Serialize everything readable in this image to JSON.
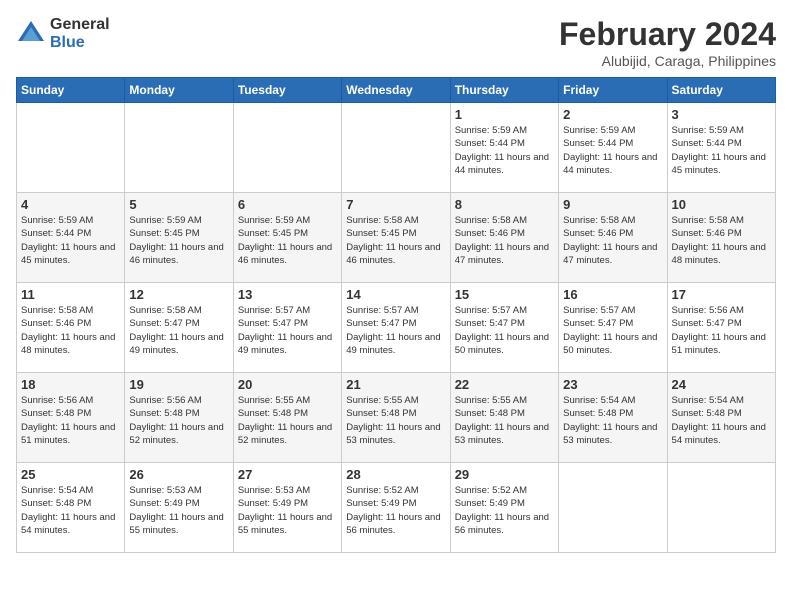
{
  "logo": {
    "general": "General",
    "blue": "Blue"
  },
  "title": "February 2024",
  "subtitle": "Alubijid, Caraga, Philippines",
  "headers": [
    "Sunday",
    "Monday",
    "Tuesday",
    "Wednesday",
    "Thursday",
    "Friday",
    "Saturday"
  ],
  "weeks": [
    [
      {
        "day": "",
        "info": ""
      },
      {
        "day": "",
        "info": ""
      },
      {
        "day": "",
        "info": ""
      },
      {
        "day": "",
        "info": ""
      },
      {
        "day": "1",
        "info": "Sunrise: 5:59 AM\nSunset: 5:44 PM\nDaylight: 11 hours\nand 44 minutes."
      },
      {
        "day": "2",
        "info": "Sunrise: 5:59 AM\nSunset: 5:44 PM\nDaylight: 11 hours\nand 44 minutes."
      },
      {
        "day": "3",
        "info": "Sunrise: 5:59 AM\nSunset: 5:44 PM\nDaylight: 11 hours\nand 45 minutes."
      }
    ],
    [
      {
        "day": "4",
        "info": "Sunrise: 5:59 AM\nSunset: 5:44 PM\nDaylight: 11 hours\nand 45 minutes."
      },
      {
        "day": "5",
        "info": "Sunrise: 5:59 AM\nSunset: 5:45 PM\nDaylight: 11 hours\nand 46 minutes."
      },
      {
        "day": "6",
        "info": "Sunrise: 5:59 AM\nSunset: 5:45 PM\nDaylight: 11 hours\nand 46 minutes."
      },
      {
        "day": "7",
        "info": "Sunrise: 5:58 AM\nSunset: 5:45 PM\nDaylight: 11 hours\nand 46 minutes."
      },
      {
        "day": "8",
        "info": "Sunrise: 5:58 AM\nSunset: 5:46 PM\nDaylight: 11 hours\nand 47 minutes."
      },
      {
        "day": "9",
        "info": "Sunrise: 5:58 AM\nSunset: 5:46 PM\nDaylight: 11 hours\nand 47 minutes."
      },
      {
        "day": "10",
        "info": "Sunrise: 5:58 AM\nSunset: 5:46 PM\nDaylight: 11 hours\nand 48 minutes."
      }
    ],
    [
      {
        "day": "11",
        "info": "Sunrise: 5:58 AM\nSunset: 5:46 PM\nDaylight: 11 hours\nand 48 minutes."
      },
      {
        "day": "12",
        "info": "Sunrise: 5:58 AM\nSunset: 5:47 PM\nDaylight: 11 hours\nand 49 minutes."
      },
      {
        "day": "13",
        "info": "Sunrise: 5:57 AM\nSunset: 5:47 PM\nDaylight: 11 hours\nand 49 minutes."
      },
      {
        "day": "14",
        "info": "Sunrise: 5:57 AM\nSunset: 5:47 PM\nDaylight: 11 hours\nand 49 minutes."
      },
      {
        "day": "15",
        "info": "Sunrise: 5:57 AM\nSunset: 5:47 PM\nDaylight: 11 hours\nand 50 minutes."
      },
      {
        "day": "16",
        "info": "Sunrise: 5:57 AM\nSunset: 5:47 PM\nDaylight: 11 hours\nand 50 minutes."
      },
      {
        "day": "17",
        "info": "Sunrise: 5:56 AM\nSunset: 5:47 PM\nDaylight: 11 hours\nand 51 minutes."
      }
    ],
    [
      {
        "day": "18",
        "info": "Sunrise: 5:56 AM\nSunset: 5:48 PM\nDaylight: 11 hours\nand 51 minutes."
      },
      {
        "day": "19",
        "info": "Sunrise: 5:56 AM\nSunset: 5:48 PM\nDaylight: 11 hours\nand 52 minutes."
      },
      {
        "day": "20",
        "info": "Sunrise: 5:55 AM\nSunset: 5:48 PM\nDaylight: 11 hours\nand 52 minutes."
      },
      {
        "day": "21",
        "info": "Sunrise: 5:55 AM\nSunset: 5:48 PM\nDaylight: 11 hours\nand 53 minutes."
      },
      {
        "day": "22",
        "info": "Sunrise: 5:55 AM\nSunset: 5:48 PM\nDaylight: 11 hours\nand 53 minutes."
      },
      {
        "day": "23",
        "info": "Sunrise: 5:54 AM\nSunset: 5:48 PM\nDaylight: 11 hours\nand 53 minutes."
      },
      {
        "day": "24",
        "info": "Sunrise: 5:54 AM\nSunset: 5:48 PM\nDaylight: 11 hours\nand 54 minutes."
      }
    ],
    [
      {
        "day": "25",
        "info": "Sunrise: 5:54 AM\nSunset: 5:48 PM\nDaylight: 11 hours\nand 54 minutes."
      },
      {
        "day": "26",
        "info": "Sunrise: 5:53 AM\nSunset: 5:49 PM\nDaylight: 11 hours\nand 55 minutes."
      },
      {
        "day": "27",
        "info": "Sunrise: 5:53 AM\nSunset: 5:49 PM\nDaylight: 11 hours\nand 55 minutes."
      },
      {
        "day": "28",
        "info": "Sunrise: 5:52 AM\nSunset: 5:49 PM\nDaylight: 11 hours\nand 56 minutes."
      },
      {
        "day": "29",
        "info": "Sunrise: 5:52 AM\nSunset: 5:49 PM\nDaylight: 11 hours\nand 56 minutes."
      },
      {
        "day": "",
        "info": ""
      },
      {
        "day": "",
        "info": ""
      }
    ]
  ]
}
